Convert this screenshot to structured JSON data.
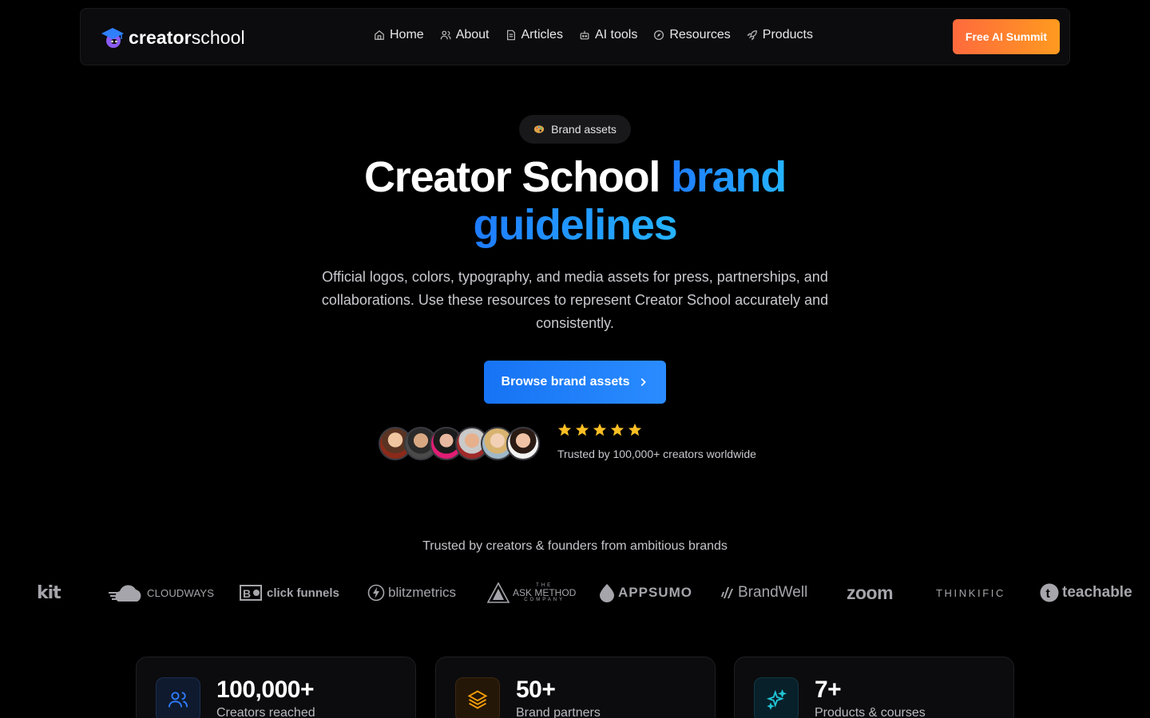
{
  "header": {
    "logo": {
      "part1": "creator",
      "part2": "school"
    },
    "menu": [
      {
        "label": "Home",
        "icon": "home-icon"
      },
      {
        "label": "About",
        "icon": "users-icon"
      },
      {
        "label": "Articles",
        "icon": "document-icon"
      },
      {
        "label": "AI tools",
        "icon": "robot-icon"
      },
      {
        "label": "Resources",
        "icon": "compass-icon"
      },
      {
        "label": "Products",
        "icon": "rocket-icon"
      }
    ],
    "cta_label": "Free AI Summit"
  },
  "hero": {
    "badge": "Brand assets",
    "title_white": "Creator School ",
    "title_accent_1": "brand",
    "title_accent_2": "guidelines",
    "lead": "Official logos, colors, typography, and media assets for press, partnerships, and collaborations. Use these resources to represent Creator School accurately and consistently.",
    "cta_label": "Browse brand assets",
    "rating_stars": 5,
    "trust_text": "Trusted by 100,000+ creators worldwide"
  },
  "brands": {
    "title": "Trusted by creators & founders from ambitious brands",
    "items": [
      "kit",
      "CLOUDWAYS",
      "click funnels",
      "blitzmetrics",
      "ASK METHOD",
      "APPSUMO",
      "BrandWell",
      "zoom",
      "THINKIFIC",
      "teachable"
    ],
    "ask_method_small_top": "THE",
    "ask_method_small_bottom": "COMPANY"
  },
  "stats": [
    {
      "value": "100,000+",
      "label": "Creators reached",
      "icon": "users-icon",
      "color": "#2f7dff"
    },
    {
      "value": "50+",
      "label": "Brand partners",
      "icon": "layers-icon",
      "color": "#f59e0b"
    },
    {
      "value": "7+",
      "label": "Products & courses",
      "icon": "sparkles-icon",
      "color": "#22c5d6"
    }
  ],
  "colors": {
    "accent_blue": "#1e7bff",
    "accent_orange": "#ff6a3d",
    "star": "#fbbf24"
  }
}
